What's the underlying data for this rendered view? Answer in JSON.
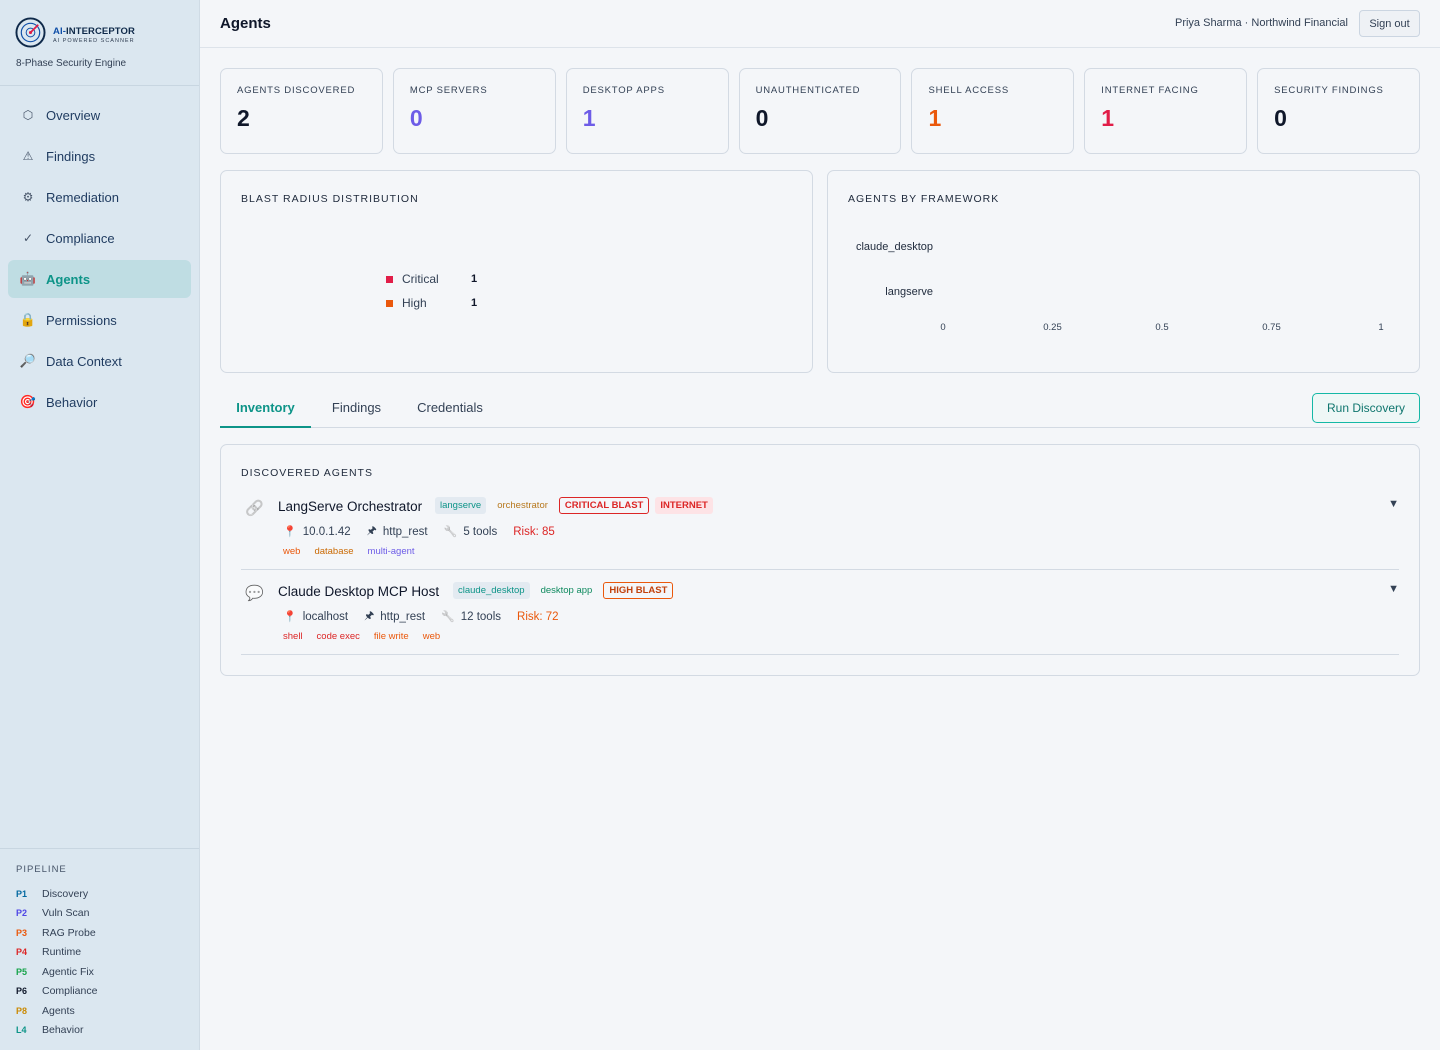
{
  "brand": {
    "name_prefix": "AI-",
    "name_main": "INTERCEPTOR",
    "subtitle": "AI POWERED SCANNER",
    "tagline": "8-Phase Security Engine"
  },
  "nav": [
    {
      "label": "Overview",
      "icon": "hexagon-icon",
      "glyph": "⬡"
    },
    {
      "label": "Findings",
      "icon": "warning-icon",
      "glyph": "⚠"
    },
    {
      "label": "Remediation",
      "icon": "gear-icon",
      "glyph": "⚙"
    },
    {
      "label": "Compliance",
      "icon": "check-icon",
      "glyph": "✓"
    },
    {
      "label": "Agents",
      "icon": "robot-icon",
      "glyph": "🤖"
    },
    {
      "label": "Permissions",
      "icon": "lock-icon",
      "glyph": "🔒"
    },
    {
      "label": "Data Context",
      "icon": "magnifier-icon",
      "glyph": "🔎"
    },
    {
      "label": "Behavior",
      "icon": "target-icon",
      "glyph": "🎯"
    }
  ],
  "active_nav": "Agents",
  "pipeline": {
    "title": "PIPELINE",
    "items": [
      {
        "code": "P1",
        "label": "Discovery",
        "color": "#0369a1"
      },
      {
        "code": "P2",
        "label": "Vuln Scan",
        "color": "#4f46e5"
      },
      {
        "code": "P3",
        "label": "RAG Probe",
        "color": "#ea580c"
      },
      {
        "code": "P4",
        "label": "Runtime",
        "color": "#dc2626"
      },
      {
        "code": "P5",
        "label": "Agentic Fix",
        "color": "#16a34a"
      },
      {
        "code": "P6",
        "label": "Compliance",
        "color": "#0f172a"
      },
      {
        "code": "P8",
        "label": "Agents",
        "color": "#ca8a04"
      },
      {
        "code": "L4",
        "label": "Behavior",
        "color": "#0d9488"
      }
    ]
  },
  "header": {
    "title": "Agents",
    "user": "Priya Sharma · Northwind Financial",
    "signout": "Sign out"
  },
  "stats": [
    {
      "label": "AGENTS DISCOVERED",
      "value": "2",
      "color": "#0f172a"
    },
    {
      "label": "MCP SERVERS",
      "value": "0",
      "color": "#6d5ce7"
    },
    {
      "label": "DESKTOP APPS",
      "value": "1",
      "color": "#6d5ce7"
    },
    {
      "label": "UNAUTHENTICATED",
      "value": "0",
      "color": "#0f172a"
    },
    {
      "label": "SHELL ACCESS",
      "value": "1",
      "color": "#ea580c"
    },
    {
      "label": "INTERNET FACING",
      "value": "1",
      "color": "#e11d48"
    },
    {
      "label": "SECURITY FINDINGS",
      "value": "0",
      "color": "#0f172a"
    }
  ],
  "blast": {
    "title": "BLAST RADIUS DISTRIBUTION",
    "legend": [
      {
        "label": "Critical",
        "value": "1",
        "color": "#e11d48"
      },
      {
        "label": "High",
        "value": "1",
        "color": "#ea580c"
      }
    ]
  },
  "chart_data": {
    "type": "bar",
    "title": "AGENTS BY FRAMEWORK",
    "categories": [
      "claude_desktop",
      "langserve"
    ],
    "values": [
      0,
      0
    ],
    "xlim": [
      0,
      1
    ],
    "x_ticks": [
      "0",
      "0.25",
      "0.5",
      "0.75",
      "1"
    ],
    "orientation": "horizontal",
    "grid": false
  },
  "tabs": [
    {
      "label": "Inventory"
    },
    {
      "label": "Findings"
    },
    {
      "label": "Credentials"
    }
  ],
  "run_discovery": "Run Discovery",
  "agents_title": "DISCOVERED AGENTS",
  "agents": [
    {
      "name": "LangServe Orchestrator",
      "icon": "link-icon",
      "framework": "langserve",
      "role": "orchestrator",
      "blast": "CRITICAL BLAST",
      "extra": "INTERNET",
      "host": "10.0.1.42",
      "protocol": "http_rest",
      "tools": "5 tools",
      "risk": "Risk: 85",
      "caps": [
        {
          "label": "web",
          "color": "#ea580c"
        },
        {
          "label": "database",
          "color": "#ca6a04"
        },
        {
          "label": "multi-agent",
          "color": "#6d5ce7"
        }
      ]
    },
    {
      "name": "Claude Desktop MCP Host",
      "icon": "chat-icon",
      "framework": "claude_desktop",
      "role": "desktop app",
      "blast": "HIGH BLAST",
      "host": "localhost",
      "protocol": "http_rest",
      "tools": "12 tools",
      "risk": "Risk: 72",
      "caps": [
        {
          "label": "shell",
          "color": "#dc2626"
        },
        {
          "label": "code exec",
          "color": "#dc2626"
        },
        {
          "label": "file write",
          "color": "#ea580c"
        },
        {
          "label": "web",
          "color": "#ea580c"
        }
      ]
    }
  ]
}
